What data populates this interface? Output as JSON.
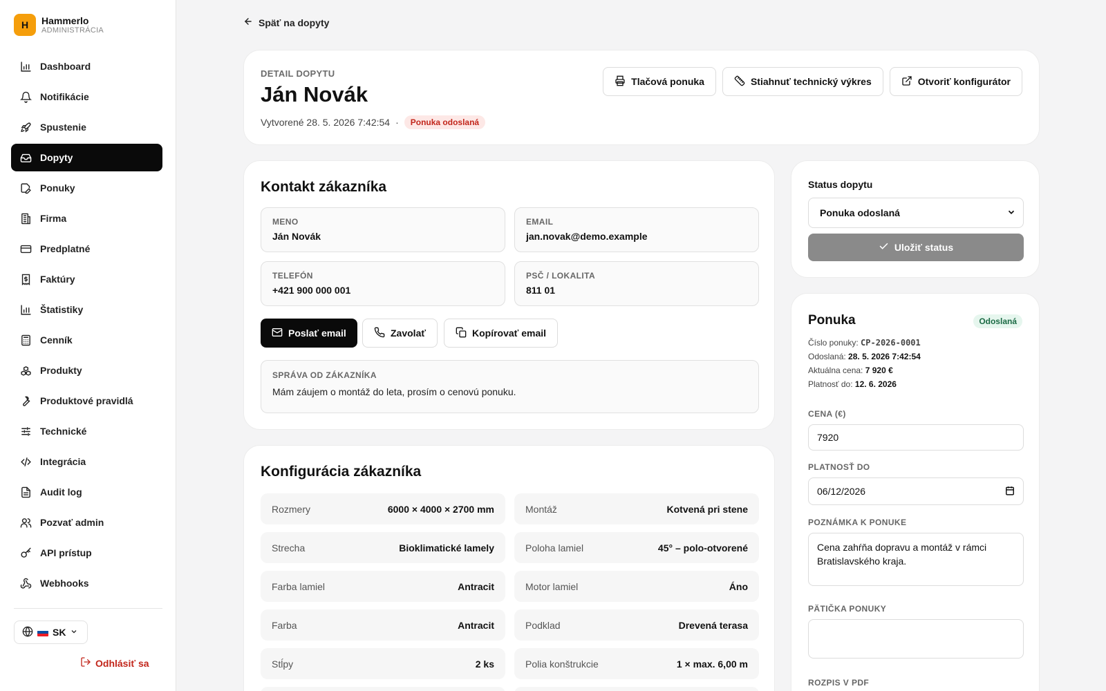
{
  "brand": {
    "logo_letter": "H",
    "name": "Hammerlo",
    "subtitle": "ADMINISTRÁCIA"
  },
  "sidebar": {
    "items": [
      {
        "label": "Dashboard",
        "icon": "bar-chart-icon"
      },
      {
        "label": "Notifikácie",
        "icon": "bell-icon"
      },
      {
        "label": "Spustenie",
        "icon": "rocket-icon"
      },
      {
        "label": "Dopyty",
        "icon": "inbox-icon",
        "active": true
      },
      {
        "label": "Ponuky",
        "icon": "edit-icon"
      },
      {
        "label": "Firma",
        "icon": "building-icon"
      },
      {
        "label": "Predplatné",
        "icon": "credit-card-icon"
      },
      {
        "label": "Faktúry",
        "icon": "receipt-icon"
      },
      {
        "label": "Štatistiky",
        "icon": "stats-icon"
      },
      {
        "label": "Cenník",
        "icon": "calculator-icon"
      },
      {
        "label": "Produkty",
        "icon": "boxes-icon"
      },
      {
        "label": "Produktové pravidlá",
        "icon": "wrench-icon"
      },
      {
        "label": "Technické",
        "icon": "sliders-icon"
      },
      {
        "label": "Integrácia",
        "icon": "code-icon"
      },
      {
        "label": "Audit log",
        "icon": "file-text-icon"
      },
      {
        "label": "Pozvať admin",
        "icon": "users-icon"
      },
      {
        "label": "API prístup",
        "icon": "key-icon"
      },
      {
        "label": "Webhooks",
        "icon": "webhook-icon"
      }
    ],
    "language": "SK",
    "logout": "Odhlásiť sa"
  },
  "back_link": "Späť na dopyty",
  "header": {
    "eyebrow": "DETAIL DOPYTU",
    "name": "Ján Novák",
    "created": "Vytvorené 28. 5. 2026 7:42:54",
    "separator": "·",
    "status_badge": "Ponuka odoslaná",
    "actions": {
      "print": "Tlačová ponuka",
      "download": "Stiahnuť technický výkres",
      "configurator": "Otvoriť konfigurátor"
    }
  },
  "contact": {
    "title": "Kontakt zákazníka",
    "name_label": "MENO",
    "name_value": "Ján Novák",
    "email_label": "EMAIL",
    "email_value": "jan.novak@demo.example",
    "phone_label": "TELEFÓN",
    "phone_value": "+421 900 000 001",
    "zip_label": "PSČ / LOKALITA",
    "zip_value": "811 01",
    "send_email": "Poslať email",
    "call": "Zavolať",
    "copy_email": "Kopírovať email",
    "message_label": "SPRÁVA OD ZÁKAZNÍKA",
    "message": "Mám záujem o montáž do leta, prosím o cenovú ponuku."
  },
  "config": {
    "title": "Konfigurácia zákazníka",
    "rows": [
      {
        "label": "Rozmery",
        "value": "6000 × 4000 × 2700 mm"
      },
      {
        "label": "Montáž",
        "value": "Kotvená pri stene"
      },
      {
        "label": "Strecha",
        "value": "Bioklimatické lamely"
      },
      {
        "label": "Poloha lamiel",
        "value": "45° – polo-otvorené"
      },
      {
        "label": "Farba lamiel",
        "value": "Antracit"
      },
      {
        "label": "Motor lamiel",
        "value": "Áno"
      },
      {
        "label": "Farba",
        "value": "Antracit"
      },
      {
        "label": "Podklad",
        "value": "Drevená terasa"
      },
      {
        "label": "Stĺpy",
        "value": "2 ks"
      },
      {
        "label": "Polia konštrukcie",
        "value": "1 × max. 6,00 m"
      }
    ]
  },
  "status": {
    "label": "Status dopytu",
    "selected": "Ponuka odoslaná",
    "save": "Uložiť status"
  },
  "offer": {
    "title": "Ponuka",
    "badge": "Odoslaná",
    "number_label": "Číslo ponuky:",
    "number": "CP-2026-0001",
    "sent_label": "Odoslaná:",
    "sent": "28. 5. 2026 7:42:54",
    "price_label": "Aktuálna cena:",
    "price": "7 920 €",
    "valid_label": "Platnosť do:",
    "valid": "12. 6. 2026",
    "price_field_label": "CENA (€)",
    "price_field": "7920",
    "validity_field_label": "PLATNOSŤ DO",
    "validity_field": "06/12/2026",
    "note_label": "POZNÁMKA K PONUKE",
    "note": "Cena zahŕňa dopravu a montáž v rámci Bratislavského kraja.",
    "footer_label": "PÄTIČKA PONUKY",
    "footer": "",
    "pdf_label": "ROZPIS V PDF"
  },
  "colors": {
    "accent": "#0a0a0a",
    "brand": "#f59e0b",
    "danger": "#c2261b",
    "success_bg": "#e6f6ee"
  }
}
